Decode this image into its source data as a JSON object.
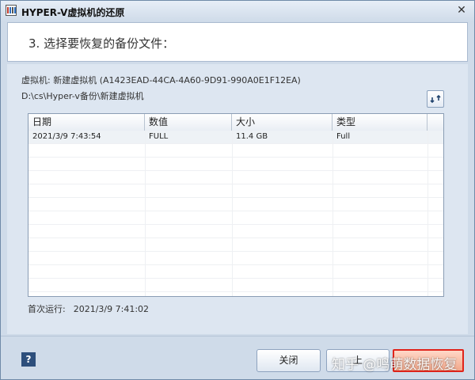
{
  "window": {
    "title": "HYPER-V虚拟机的还原",
    "close_glyph": "✕"
  },
  "header": {
    "step_title": "3. 选择要恢复的备份文件："
  },
  "vm": {
    "info": "虚拟机: 新建虚拟机 (A1423EAD-44CA-4A60-9D91-990A0E1F12EA)",
    "path": "D:\\cs\\Hyper-v备份\\新建虚拟机"
  },
  "table": {
    "columns": [
      "日期",
      "数值",
      "大小",
      "类型"
    ],
    "rows": [
      [
        "2021/3/9 7:43:54",
        "FULL",
        "11.4 GB",
        "Full"
      ]
    ]
  },
  "first_run": {
    "label": "首次运行:",
    "value": "2021/3/9 7:41:02"
  },
  "footer": {
    "help_label": "?",
    "close_label": "关闭",
    "prev_label": "上",
    "watermark": "知乎 @鸣萌数据恢复"
  },
  "colors": {
    "accent_border": "#e0241b",
    "window_bg": "#cfdbe9",
    "content_bg": "#dde6f1"
  },
  "icons": [
    "app-icon",
    "close-icon",
    "refresh-icon",
    "help-icon"
  ]
}
